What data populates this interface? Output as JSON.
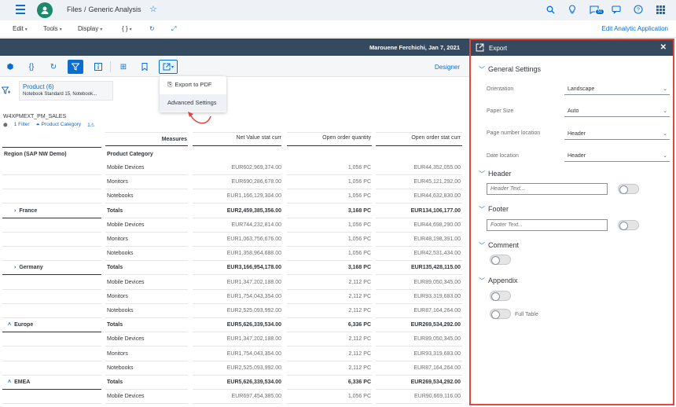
{
  "shell": {
    "avatar_initial": "ⓘ",
    "crumb_files": "Files",
    "crumb_sep": "/",
    "crumb_current": "Generic Analysis",
    "notification_count": "51"
  },
  "menubar": {
    "edit": "Edit",
    "tools": "Tools",
    "display": "Display",
    "braces": "{ }",
    "edit_app": "Edit Analytic Application"
  },
  "header": {
    "user_date": "Marouene Ferchichi, Jan 7, 2021"
  },
  "toolbar": {
    "designer": "Designer"
  },
  "filter": {
    "title": "Product (6)",
    "subtitle": "Notebook Standard 15, Notebook..."
  },
  "dropdown": {
    "export_pdf": "Export to PDF",
    "advanced_settings": "Advanced Settings"
  },
  "table": {
    "name": "W4XPMEXT_PM_SALES",
    "chip_filter": "1 Filter",
    "chip_category": "Product Category",
    "chip_count": "1",
    "measures_label": "Measures",
    "columns": [
      "Net Value stat curr",
      "Open order quantity",
      "Open order stat curr"
    ],
    "region_header": "Region (SAP NW Demo)",
    "category_header": "Product Category",
    "rows": [
      {
        "region": "",
        "category": "Mobile Devices",
        "v1": "EUR602,969,374.00",
        "v2": "1,056 PC",
        "v3": "EUR44,352,055.00",
        "bold": false
      },
      {
        "region": "",
        "category": "Monitors",
        "v1": "EUR690,286,678.00",
        "v2": "1,056 PC",
        "v3": "EUR45,121,292.00",
        "bold": false
      },
      {
        "region": "",
        "category": "Notebooks",
        "v1": "EUR1,166,129,304.00",
        "v2": "1,056 PC",
        "v3": "EUR44,632,830.00",
        "bold": false
      },
      {
        "region": "France",
        "category": "Totals",
        "v1": "EUR2,459,385,356.00",
        "v2": "3,168 PC",
        "v3": "EUR134,106,177.00",
        "bold": true,
        "chev": "›"
      },
      {
        "region": "",
        "category": "Mobile Devices",
        "v1": "EUR744,232,814.00",
        "v2": "1,056 PC",
        "v3": "EUR44,698,290.00",
        "bold": false
      },
      {
        "region": "",
        "category": "Monitors",
        "v1": "EUR1,063,756,676.00",
        "v2": "1,056 PC",
        "v3": "EUR48,198,391.00",
        "bold": false
      },
      {
        "region": "",
        "category": "Notebooks",
        "v1": "EUR1,358,964,688.00",
        "v2": "1,056 PC",
        "v3": "EUR42,531,434.00",
        "bold": false
      },
      {
        "region": "Germany",
        "category": "Totals",
        "v1": "EUR3,166,954,178.00",
        "v2": "3,168 PC",
        "v3": "EUR135,428,115.00",
        "bold": true,
        "chev": "›"
      },
      {
        "region": "",
        "category": "Mobile Devices",
        "v1": "EUR1,347,202,188.00",
        "v2": "2,112 PC",
        "v3": "EUR89,050,345.00",
        "bold": false
      },
      {
        "region": "",
        "category": "Monitors",
        "v1": "EUR1,754,043,354.00",
        "v2": "2,112 PC",
        "v3": "EUR93,319,683.00",
        "bold": false
      },
      {
        "region": "",
        "category": "Notebooks",
        "v1": "EUR2,525,093,992.00",
        "v2": "2,112 PC",
        "v3": "EUR87,164,264.00",
        "bold": false
      },
      {
        "region": "Europe",
        "category": "Totals",
        "v1": "EUR5,626,339,534.00",
        "v2": "6,336 PC",
        "v3": "EUR269,534,292.00",
        "bold": true,
        "chev": "˄"
      },
      {
        "region": "",
        "category": "Mobile Devices",
        "v1": "EUR1,347,202,188.00",
        "v2": "2,112 PC",
        "v3": "EUR89,050,345.00",
        "bold": false
      },
      {
        "region": "",
        "category": "Monitors",
        "v1": "EUR1,754,043,354.00",
        "v2": "2,112 PC",
        "v3": "EUR93,319,683.00",
        "bold": false
      },
      {
        "region": "",
        "category": "Notebooks",
        "v1": "EUR2,525,093,992.00",
        "v2": "2,112 PC",
        "v3": "EUR87,164,264.00",
        "bold": false
      },
      {
        "region": "EMEA",
        "category": "Totals",
        "v1": "EUR5,626,339,534.00",
        "v2": "6,336 PC",
        "v3": "EUR269,534,292.00",
        "bold": true,
        "chev": "˄"
      },
      {
        "region": "",
        "category": "Mobile Devices",
        "v1": "EUR697,454,385.00",
        "v2": "1,056 PC",
        "v3": "EUR90,669,116.00",
        "bold": false
      }
    ]
  },
  "panel": {
    "title": "Export",
    "general_settings": "General Settings",
    "orientation_label": "Orientation",
    "orientation_value": "Landscape",
    "paper_label": "Paper Size",
    "paper_value": "Auto",
    "page_number_label": "Page number location",
    "page_number_value": "Header",
    "date_label": "Date location",
    "date_value": "Header",
    "header_section": "Header",
    "header_placeholder": "Header Text...",
    "footer_section": "Footer",
    "footer_placeholder": "Footer Text...",
    "comment_section": "Comment",
    "appendix_section": "Appendix",
    "full_table": "Full Table"
  }
}
